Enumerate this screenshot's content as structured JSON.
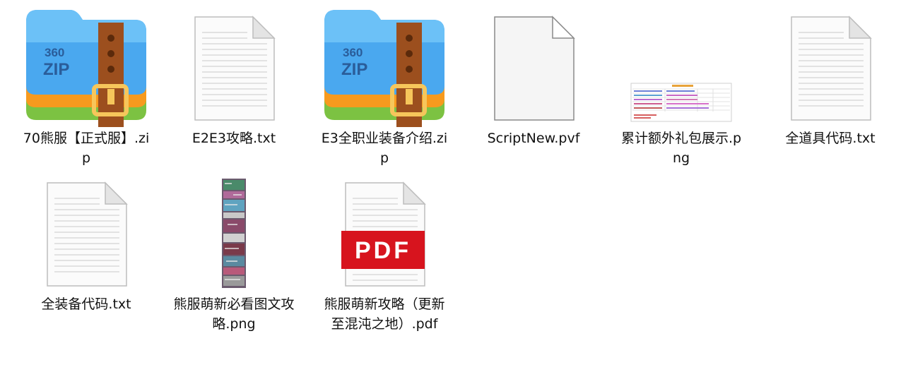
{
  "files": [
    {
      "name": "70熊服【正式服】.zip",
      "type": "zip-archive",
      "icon": "360-zip-archive-icon"
    },
    {
      "name": "E2E3攻略.txt",
      "type": "text",
      "icon": "text-file-icon"
    },
    {
      "name": "E3全职业装备介绍.zip",
      "type": "zip-archive",
      "icon": "360-zip-archive-icon"
    },
    {
      "name": "ScriptNew.pvf",
      "type": "generic",
      "icon": "blank-file-icon"
    },
    {
      "name": "累计额外礼包展示.png",
      "type": "image",
      "icon": "image-thumbnail-icon"
    },
    {
      "name": "全道具代码.txt",
      "type": "text",
      "icon": "text-file-icon"
    },
    {
      "name": "全装备代码.txt",
      "type": "text",
      "icon": "text-file-icon"
    },
    {
      "name": "熊服萌新必看图文攻略.png",
      "type": "image",
      "icon": "image-thumbnail-icon"
    },
    {
      "name": "熊服萌新攻略（更新至混沌之地）.pdf",
      "type": "pdf",
      "icon": "pdf-file-icon"
    }
  ],
  "zip_icon_text": {
    "line1": "360",
    "line2": "ZIP"
  },
  "pdf_icon_text": "PDF",
  "colors": {
    "zip_blue": "#4aa8ef",
    "zip_orange": "#f79a1e",
    "zip_green": "#7cc242",
    "zip_strap": "#9c4f1e",
    "zip_buckle": "#f6c65b",
    "pdf_red": "#d7141e"
  }
}
